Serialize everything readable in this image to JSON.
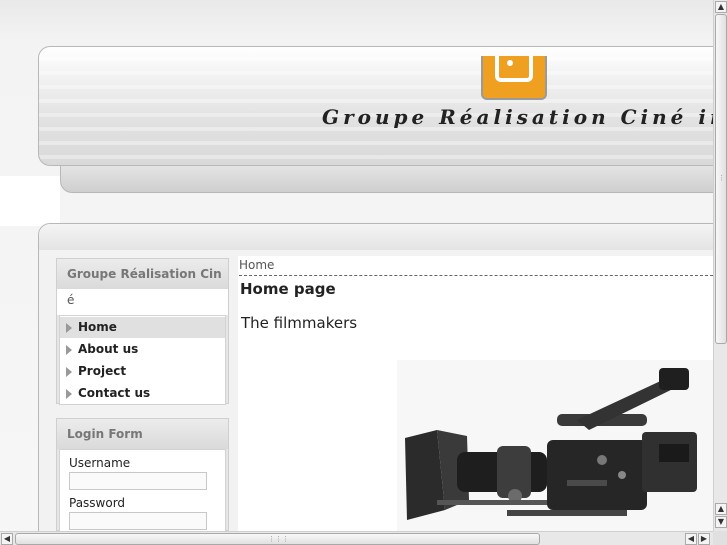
{
  "header": {
    "site_title": "Groupe Réalisation Ciné inc"
  },
  "sidebar": {
    "main_menu": {
      "title": "Groupe Réalisation Cin",
      "title_overflow": "é",
      "items": [
        {
          "label": "Home",
          "active": true
        },
        {
          "label": "About us",
          "active": false
        },
        {
          "label": "Project",
          "active": false
        },
        {
          "label": "Contact us",
          "active": false
        }
      ]
    },
    "login": {
      "title": "Login Form",
      "username_label": "Username",
      "password_label": "Password"
    }
  },
  "main": {
    "breadcrumb": "Home",
    "page_heading": "Home page",
    "section_heading": "The filmmakers",
    "image_icon": "film-camera-image"
  },
  "colors": {
    "logo_orange": "#f0a020",
    "heading_text": "#222222",
    "module_title": "#777777"
  }
}
